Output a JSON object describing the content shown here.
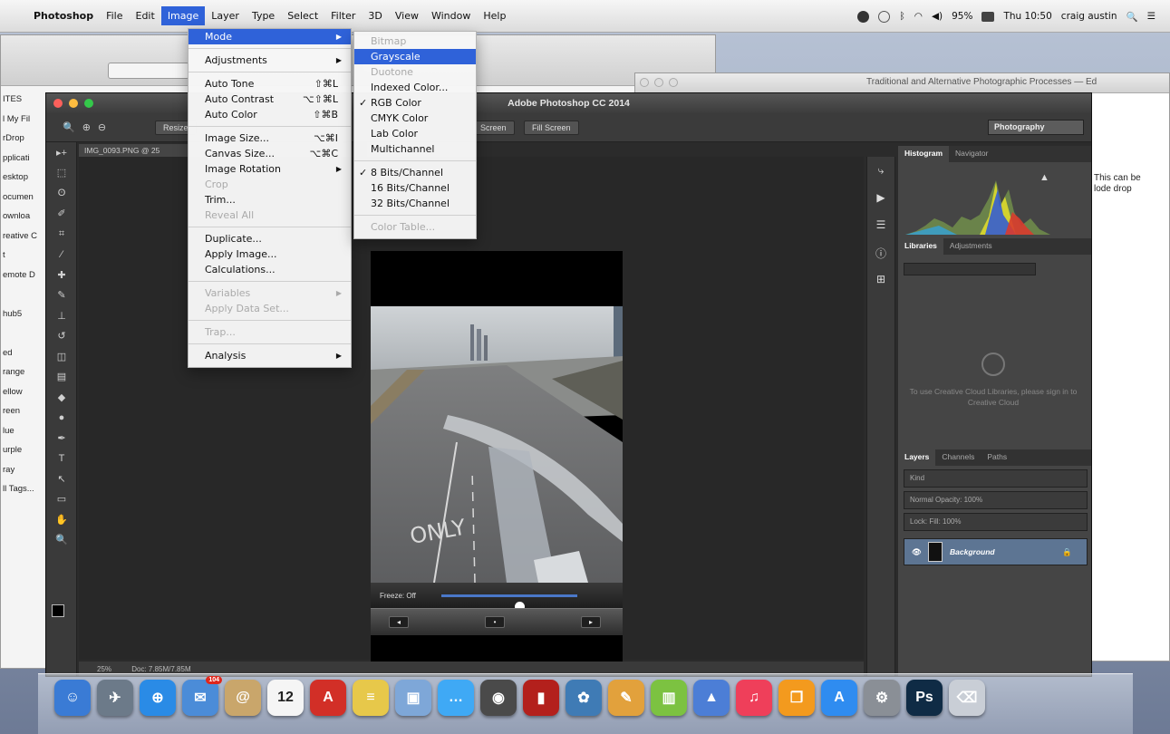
{
  "menubar": {
    "app": "Photoshop",
    "items": [
      "File",
      "Edit",
      "Image",
      "Layer",
      "Type",
      "Select",
      "Filter",
      "3D",
      "View",
      "Window",
      "Help"
    ],
    "active_index": 2,
    "battery": "95%",
    "clock": "Thu 10:50",
    "user": "craig austin"
  },
  "image_menu": {
    "mode": "Mode",
    "adjustments": "Adjustments",
    "auto_tone": "Auto Tone",
    "auto_tone_sc": "⇧⌘L",
    "auto_contrast": "Auto Contrast",
    "auto_contrast_sc": "⌥⇧⌘L",
    "auto_color": "Auto Color",
    "auto_color_sc": "⇧⌘B",
    "image_size": "Image Size...",
    "image_size_sc": "⌥⌘I",
    "canvas_size": "Canvas Size...",
    "canvas_size_sc": "⌥⌘C",
    "image_rotation": "Image Rotation",
    "crop": "Crop",
    "trim": "Trim...",
    "reveal_all": "Reveal All",
    "duplicate": "Duplicate...",
    "apply_image": "Apply Image...",
    "calculations": "Calculations...",
    "variables": "Variables",
    "apply_data_set": "Apply Data Set...",
    "trap": "Trap...",
    "analysis": "Analysis"
  },
  "mode_menu": {
    "bitmap": "Bitmap",
    "grayscale": "Grayscale",
    "duotone": "Duotone",
    "indexed_color": "Indexed Color...",
    "rgb_color": "RGB Color",
    "cmyk_color": "CMYK Color",
    "lab_color": "Lab Color",
    "multichannel": "Multichannel",
    "bits8": "8 Bits/Channel",
    "bits16": "16 Bits/Channel",
    "bits32": "32 Bits/Channel",
    "color_table": "Color Table..."
  },
  "photoshop": {
    "window_title": "Adobe Photoshop CC 2014",
    "doc_tab": "IMG_0093.PNG @ 25",
    "options": [
      "Resize",
      "Screen",
      "Fill Screen"
    ],
    "workspace": "Photography",
    "status_zoom": "25%",
    "status_doc": "Doc: 7.85M/7.85M",
    "panels": {
      "histogram_tabs": [
        "Histogram",
        "Navigator"
      ],
      "library_tabs": [
        "Libraries",
        "Adjustments"
      ],
      "library_msg": "To use Creative Cloud Libraries, please sign in to Creative Cloud",
      "layer_tabs": [
        "Layers",
        "Channels",
        "Paths"
      ],
      "kind": "Kind",
      "blend": "Normal",
      "opacity_label": "Opacity:",
      "opacity": "100%",
      "lock_label": "Lock:",
      "fill_label": "Fill:",
      "fill": "100%",
      "layer_name": "Background"
    },
    "phone_ui": {
      "freeze": "Freeze: Off",
      "slider_value": 0.58
    }
  },
  "background_windows": {
    "browser_title": "Traditional and Alternative Photographic Processes — Ed",
    "browser_note_line1": "This can be",
    "browser_note_line2": "lode drop",
    "finder_sidebar": [
      "ITES",
      "l My Fil",
      "rDrop",
      "pplicati",
      "esktop",
      "ocumen",
      "ownloa",
      "reative C",
      "t",
      "emote D",
      "",
      "hub5",
      "",
      "ed",
      "range",
      "ellow",
      "reen",
      "lue",
      "urple",
      "ray",
      "ll Tags..."
    ]
  },
  "dock": {
    "items": [
      {
        "name": "finder",
        "color": "#3a7bd5",
        "glyph": "☺"
      },
      {
        "name": "launchpad",
        "color": "#6c7a89",
        "glyph": "✈"
      },
      {
        "name": "safari",
        "color": "#2a8be6",
        "glyph": "⊕"
      },
      {
        "name": "mail",
        "color": "#4b8cd8",
        "glyph": "✉",
        "badge": "104"
      },
      {
        "name": "contacts",
        "color": "#c9a66b",
        "glyph": "@"
      },
      {
        "name": "calendar",
        "color": "#f5f5f5",
        "glyph": "12"
      },
      {
        "name": "acrobat",
        "color": "#d22f27",
        "glyph": "A"
      },
      {
        "name": "notes",
        "color": "#e7c84a",
        "glyph": "≡"
      },
      {
        "name": "preview",
        "color": "#7ea7d8",
        "glyph": "▣"
      },
      {
        "name": "messages",
        "color": "#3fa9f5",
        "glyph": "…"
      },
      {
        "name": "facetime",
        "color": "#4a4a4a",
        "glyph": "◉"
      },
      {
        "name": "photo-booth",
        "color": "#b3201c",
        "glyph": "▮"
      },
      {
        "name": "iphoto",
        "color": "#3f7bb5",
        "glyph": "✿"
      },
      {
        "name": "pages",
        "color": "#e2a13c",
        "glyph": "✎"
      },
      {
        "name": "numbers",
        "color": "#7cc241",
        "glyph": "▥"
      },
      {
        "name": "keynote",
        "color": "#4c7ed6",
        "glyph": "▲"
      },
      {
        "name": "itunes",
        "color": "#ef3f5a",
        "glyph": "♫"
      },
      {
        "name": "ibooks",
        "color": "#f39a1e",
        "glyph": "❐"
      },
      {
        "name": "app-store",
        "color": "#2f8cf0",
        "glyph": "A"
      },
      {
        "name": "system-preferences",
        "color": "#8a8f96",
        "glyph": "⚙"
      },
      {
        "name": "photoshop",
        "color": "#0f2b45",
        "glyph": "Ps"
      },
      {
        "name": "trash",
        "color": "#c9ced6",
        "glyph": "⌫"
      }
    ]
  }
}
